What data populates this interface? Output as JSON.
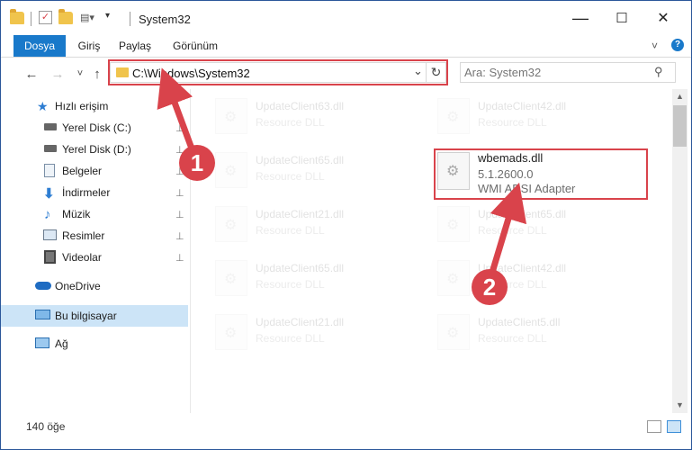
{
  "window": {
    "title": "System32",
    "minimize_glyph": "—",
    "maximize_glyph": "☐",
    "close_glyph": "✕",
    "help_glyph": "?",
    "collapse_ribbon_glyph": "˅"
  },
  "ribbon": {
    "tabs": [
      "Dosya",
      "Giriş",
      "Paylaş",
      "Görünüm"
    ],
    "file_tab_color": "#1979ca"
  },
  "address_bar": {
    "path": "C:\\Windows\\System32",
    "dropdown_glyph": "⌄",
    "refresh_glyph": "↻"
  },
  "search": {
    "placeholder": "Ara: System32",
    "icon": "search-icon"
  },
  "nav_buttons": {
    "back": "←",
    "forward": "→",
    "recent": "˅",
    "up": "↑"
  },
  "sidebar": {
    "items": [
      {
        "label": "Hızlı erişim",
        "icon": "star-icon",
        "pinned": false
      },
      {
        "label": "Yerel Disk (C:)",
        "icon": "drive-icon",
        "pinned": true
      },
      {
        "label": "Yerel Disk (D:)",
        "icon": "drive-icon",
        "pinned": true
      },
      {
        "label": "Belgeler",
        "icon": "documents-icon",
        "pinned": true
      },
      {
        "label": "İndirmeler",
        "icon": "download-icon",
        "pinned": true
      },
      {
        "label": "Müzik",
        "icon": "music-icon",
        "pinned": true
      },
      {
        "label": "Resimler",
        "icon": "pictures-icon",
        "pinned": true
      },
      {
        "label": "Videolar",
        "icon": "videos-icon",
        "pinned": true
      },
      {
        "label": "OneDrive",
        "icon": "cloud-icon",
        "pinned": false
      },
      {
        "label": "Bu bilgisayar",
        "icon": "computer-icon",
        "pinned": false,
        "selected": true
      },
      {
        "label": "Ağ",
        "icon": "network-icon",
        "pinned": false
      }
    ],
    "pin_glyph": "📌"
  },
  "files": {
    "left_column": [
      {
        "name": "UpdateClient63.dll",
        "type": "Resource DLL"
      },
      {
        "name": "UpdateClient65.dll",
        "type": "Resource DLL"
      },
      {
        "name": "UpdateClient21.dll",
        "type": "Resource DLL"
      },
      {
        "name": "UpdateClient65.dll",
        "type": "Resource DLL"
      },
      {
        "name": "UpdateClient21.dll",
        "type": "Resource DLL"
      }
    ],
    "right_column": [
      {
        "name": "UpdateClient42.dll",
        "type": "Resource DLL"
      },
      {
        "name": "UpdateClient65.dll",
        "type": "Resource DLL"
      },
      {
        "name": "UpdateClient42.dll",
        "type": "Resource DLL"
      },
      {
        "name": "UpdateClient5.dll",
        "type": "Resource DLL"
      }
    ],
    "highlighted": {
      "name": "wbemads.dll",
      "version": "5.1.2600.0",
      "description": "WMI ADSI Adapter"
    }
  },
  "callouts": {
    "one": "1",
    "two": "2",
    "color": "#d9434b"
  },
  "status_bar": {
    "item_count": "140 öğe"
  }
}
